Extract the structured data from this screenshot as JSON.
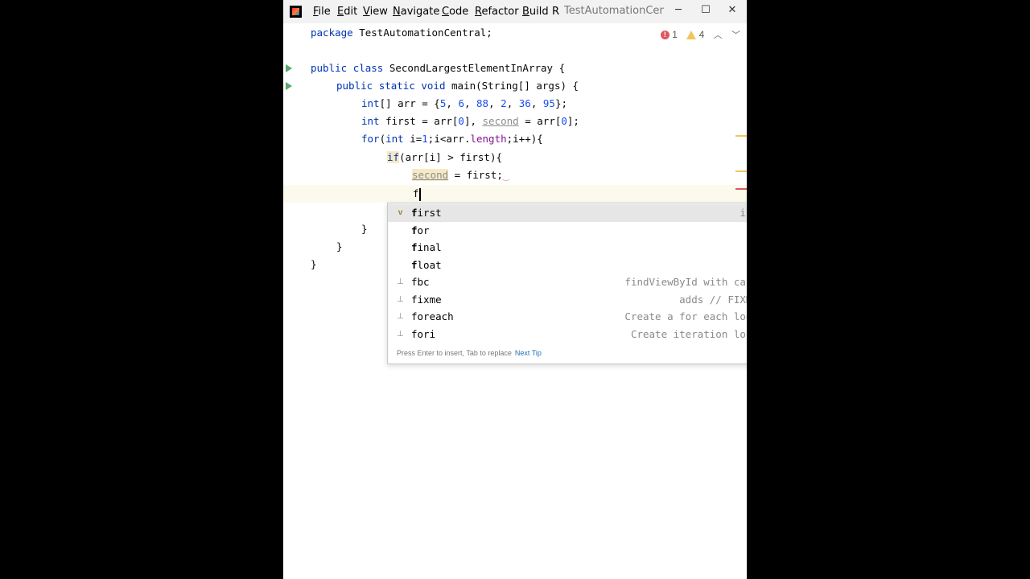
{
  "window": {
    "title": "TestAutomationCentr",
    "menu": [
      {
        "label": "File",
        "mnemonic": "F",
        "rest": "ile"
      },
      {
        "label": "Edit",
        "mnemonic": "E",
        "rest": "dit"
      },
      {
        "label": "View",
        "mnemonic": "V",
        "rest": "iew"
      },
      {
        "label": "Navigate",
        "mnemonic": "N",
        "rest": "avigate"
      },
      {
        "label": "Code",
        "mnemonic": "C",
        "rest": "ode"
      },
      {
        "label": "Refactor",
        "mnemonic": "R",
        "rest": "efactor"
      },
      {
        "label": "Build",
        "mnemonic": "B",
        "rest": "uild"
      },
      {
        "label": "R",
        "mnemonic": "R",
        "rest": ""
      }
    ],
    "controls": {
      "minimize": "─",
      "maximize": "☐",
      "close": "✕"
    }
  },
  "inspections": {
    "errors": "1",
    "warnings": "4"
  },
  "code": {
    "line1": {
      "kw": "package",
      "rest": " TestAutomationCentral;"
    },
    "line3": {
      "kw1": "public",
      "kw2": "class",
      "rest": " SecondLargestElementInArray {"
    },
    "line4": {
      "kw1": "public",
      "kw2": "static",
      "kw3": "void",
      "rest": " main(String[] args) {"
    },
    "line5": {
      "kw": "int",
      "a": "[] arr = {",
      "n1": "5",
      "c1": ", ",
      "n2": "6",
      "c2": ", ",
      "n3": "88",
      "c3": ", ",
      "n4": "2",
      "c4": ", ",
      "n5": "36",
      "c5": ", ",
      "n6": "95",
      "end": "};"
    },
    "line6": {
      "kw": "int",
      "a": " first = arr[",
      "n1": "0",
      "b": "], ",
      "unused": "second",
      "c": " = arr[",
      "n2": "0",
      "d": "];"
    },
    "line7": {
      "kw1": "for",
      "a": "(",
      "kw2": "int",
      "b": " i=",
      "n1": "1",
      "c": ";i<arr.",
      "field": "length",
      "d": ";i++){"
    },
    "line8": {
      "kw": "if",
      "a": "(arr[i] > first){"
    },
    "line9": {
      "unused": "second",
      "rest": " = first;",
      "squiggle": "‿"
    },
    "line10": {
      "typed": "f"
    },
    "line11": {
      "text": "}"
    },
    "line12": {
      "text": "}"
    },
    "line13": {
      "text": "}"
    }
  },
  "completion": {
    "items": [
      {
        "icon": "v",
        "icon_name": "variable-icon",
        "match": "f",
        "rest": "irst",
        "tail": "int"
      },
      {
        "icon": "",
        "icon_name": "keyword",
        "match": "f",
        "rest": "or",
        "tail": ""
      },
      {
        "icon": "",
        "icon_name": "keyword",
        "match": "f",
        "rest": "inal",
        "tail": ""
      },
      {
        "icon": "",
        "icon_name": "keyword",
        "match": "f",
        "rest": "loat",
        "tail": ""
      },
      {
        "icon": "⊥",
        "icon_name": "live-template-icon",
        "match": "f",
        "rest": "bc",
        "tail": "findViewById with cast"
      },
      {
        "icon": "⊥",
        "icon_name": "live-template-icon",
        "match": "f",
        "rest": "ixme",
        "tail": "adds // FIXME"
      },
      {
        "icon": "⊥",
        "icon_name": "live-template-icon",
        "match": "f",
        "rest": "oreach",
        "tail": "Create a for each loop"
      },
      {
        "icon": "⊥",
        "icon_name": "live-template-icon",
        "match": "f",
        "rest": "ori",
        "tail": "Create iteration loop"
      }
    ],
    "footer_hint": "Press Enter to insert, Tab to replace",
    "footer_link": "Next Tip"
  },
  "colors": {
    "keyword": "#0033b3",
    "number": "#1750eb",
    "error": "#db5860",
    "warning": "#f2c55c",
    "run": "#59a869"
  }
}
